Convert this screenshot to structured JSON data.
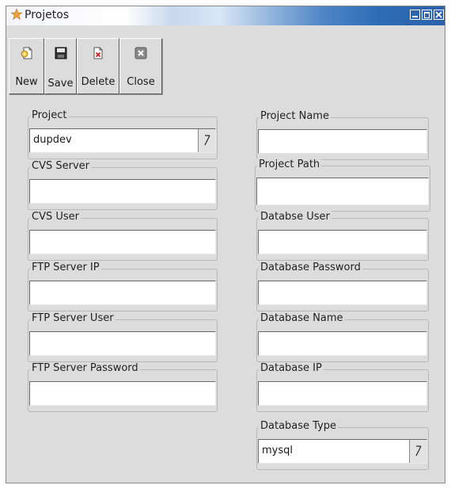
{
  "window": {
    "title": "Projetos"
  },
  "toolbar": {
    "new_label": "New",
    "save_label": "Save",
    "delete_label": "Delete",
    "close_label": "Close"
  },
  "left_fields": [
    {
      "label": "Project",
      "value": "dupdev",
      "type": "combo"
    },
    {
      "label": "CVS Server",
      "value": ""
    },
    {
      "label": "CVS User",
      "value": ""
    },
    {
      "label": "FTP Server IP",
      "value": ""
    },
    {
      "label": "FTP Server User",
      "value": ""
    },
    {
      "label": "FTP Server Password",
      "value": ""
    }
  ],
  "right_fields": [
    {
      "label": "Project Name",
      "value": ""
    },
    {
      "label": "Project Path",
      "value": ""
    },
    {
      "label": "Databse User",
      "value": ""
    },
    {
      "label": "Database Password",
      "value": ""
    },
    {
      "label": "Database Name",
      "value": ""
    },
    {
      "label": "Database IP",
      "value": ""
    },
    {
      "label": "Database Type",
      "value": "mysql",
      "type": "combo"
    }
  ],
  "colors": {
    "titlebar_accent": "#2e6cb6",
    "window_bg": "#dcdcdc"
  },
  "icons": [
    "star-icon",
    "minimize-icon",
    "maximize-icon",
    "close-icon",
    "new-icon",
    "save-icon",
    "delete-icon",
    "close-doc-icon",
    "dropdown-arrow-icon"
  ]
}
